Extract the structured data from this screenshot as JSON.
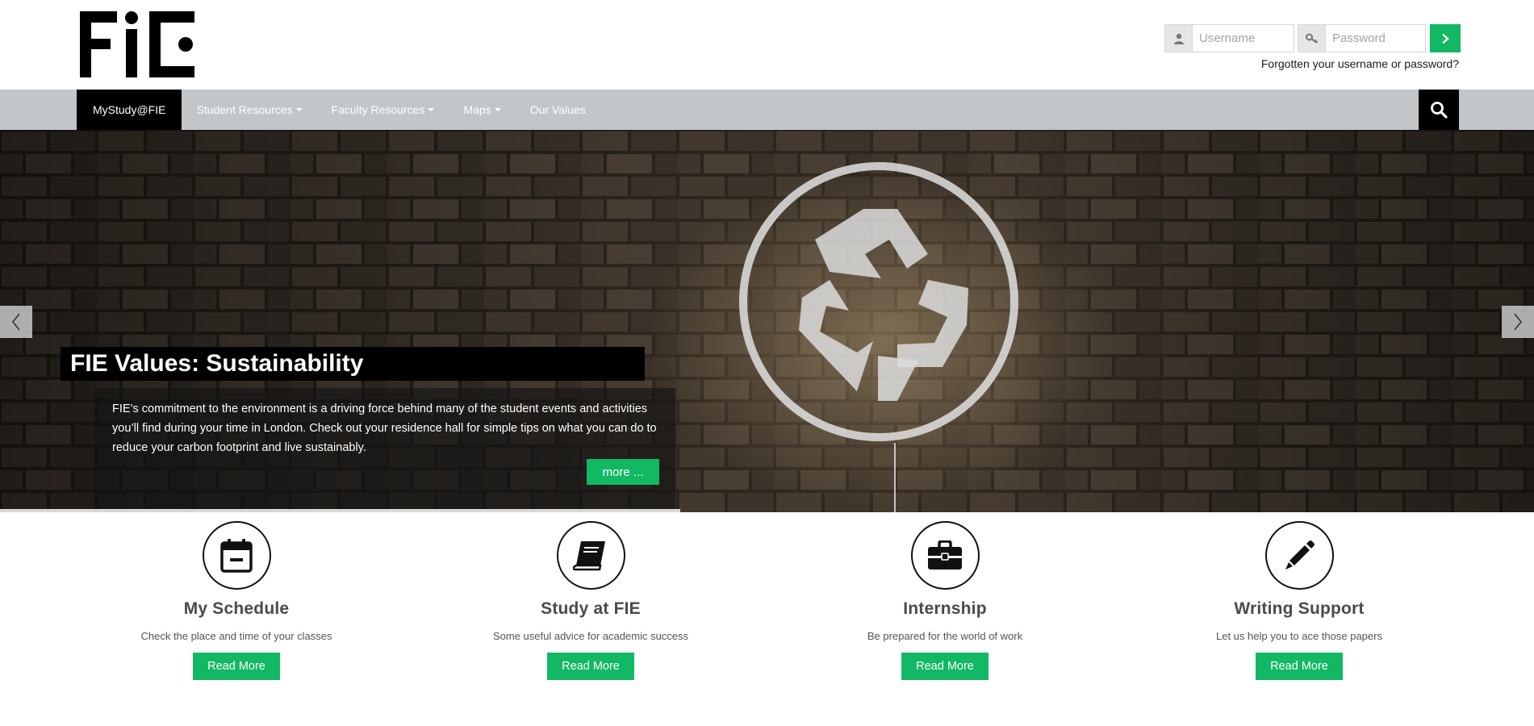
{
  "brand": {
    "logo_text": "FIE"
  },
  "login": {
    "username_placeholder": "Username",
    "password_placeholder": "Password",
    "forgot_label": "Forgotten your username or password?"
  },
  "nav": {
    "items": [
      {
        "label": "MyStudy@FIE",
        "active": true,
        "dropdown": false
      },
      {
        "label": "Student Resources",
        "active": false,
        "dropdown": true
      },
      {
        "label": "Faculty Resources",
        "active": false,
        "dropdown": true
      },
      {
        "label": "Maps",
        "active": false,
        "dropdown": true
      },
      {
        "label": "Our Values",
        "active": false,
        "dropdown": false
      }
    ]
  },
  "hero": {
    "title": "FIE Values: Sustainability",
    "text": "FIE’s commitment to the environment is a driving force behind many of the student events and activities you’ll find during your time in London. Check out your residence hall for simple tips on what you can do to reduce your carbon footprint and live sustainably.",
    "more_label": "more ..."
  },
  "features": [
    {
      "icon": "calendar-icon",
      "title": "My Schedule",
      "description": "Check the place and time of your classes",
      "button": "Read More"
    },
    {
      "icon": "book-icon",
      "title": "Study at FIE",
      "description": "Some useful advice for academic success",
      "button": "Read More"
    },
    {
      "icon": "briefcase-icon",
      "title": "Internship",
      "description": "Be prepared for the world of work",
      "button": "Read More"
    },
    {
      "icon": "pencil-icon",
      "title": "Writing Support",
      "description": "Let us help you to ace those papers",
      "button": "Read More"
    }
  ],
  "colors": {
    "accent": "#12b864",
    "navbar": "#c3c6c8",
    "dark": "#000000"
  }
}
